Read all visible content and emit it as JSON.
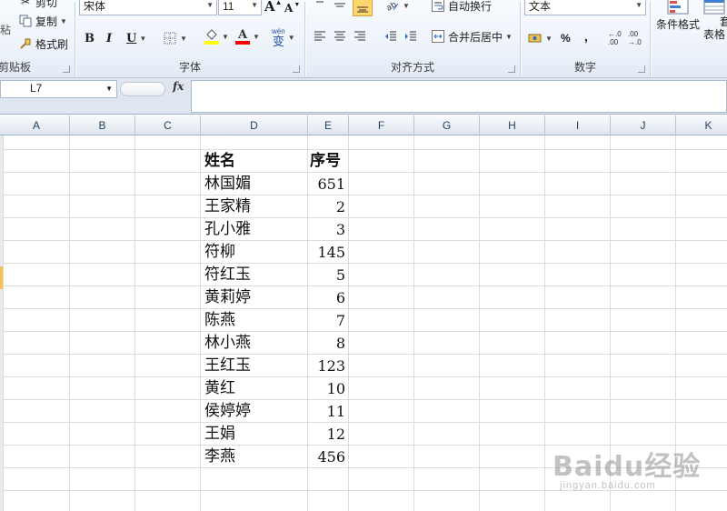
{
  "ribbon": {
    "clipboard": {
      "label": "剪贴板",
      "cut": "剪切",
      "copy": "复制",
      "format_painter": "格式刷",
      "paste_fragment": "粘"
    },
    "font": {
      "label": "字体",
      "name": "宋体",
      "size": "11",
      "grow": "A",
      "shrink": "A",
      "bold": "B",
      "italic": "I",
      "underline": "U",
      "phonetic": "wén",
      "phonetic_char": "变",
      "font_color_letter": "A",
      "fill_color": "#ffff00",
      "font_color": "#ff0000"
    },
    "alignment": {
      "label": "对齐方式",
      "wrap_text": "自动换行",
      "merge_center": "合并后居中"
    },
    "number": {
      "label": "数字",
      "format": "文本",
      "percent": "%",
      "comma": ",",
      "inc_decimal": "+.0 .00",
      "dec_decimal": ".00 →.0"
    },
    "styles": {
      "conditional_format": "条件格式",
      "table_format": "表格",
      "table_format_top": "套"
    }
  },
  "formula_bar": {
    "name_box": "L7",
    "fx": "fx",
    "formula": ""
  },
  "columns": [
    "A",
    "B",
    "C",
    "D",
    "E",
    "F",
    "G",
    "H",
    "I",
    "J",
    "K"
  ],
  "table": {
    "headers": [
      "姓名",
      "序号"
    ],
    "rows": [
      [
        "林国媚",
        "651"
      ],
      [
        "王家精",
        "2"
      ],
      [
        "孔小雅",
        "3"
      ],
      [
        "符柳",
        "145"
      ],
      [
        "符红玉",
        "5"
      ],
      [
        "黄莉婷",
        "6"
      ],
      [
        "陈燕",
        "7"
      ],
      [
        "林小燕",
        "8"
      ],
      [
        "王红玉",
        "123"
      ],
      [
        "黄红",
        "10"
      ],
      [
        "侯婷婷",
        "11"
      ],
      [
        "王娟",
        "12"
      ],
      [
        "李燕",
        "456"
      ]
    ]
  },
  "watermark": {
    "logo": "Baidu经验",
    "url": "jingyan.baidu.com"
  },
  "colors": {
    "ribbon_bg": "#eef3fa",
    "header_bg": "#dfe5ee",
    "gridline": "#dadcdd",
    "selected_row_marker": "#f5c24b"
  }
}
